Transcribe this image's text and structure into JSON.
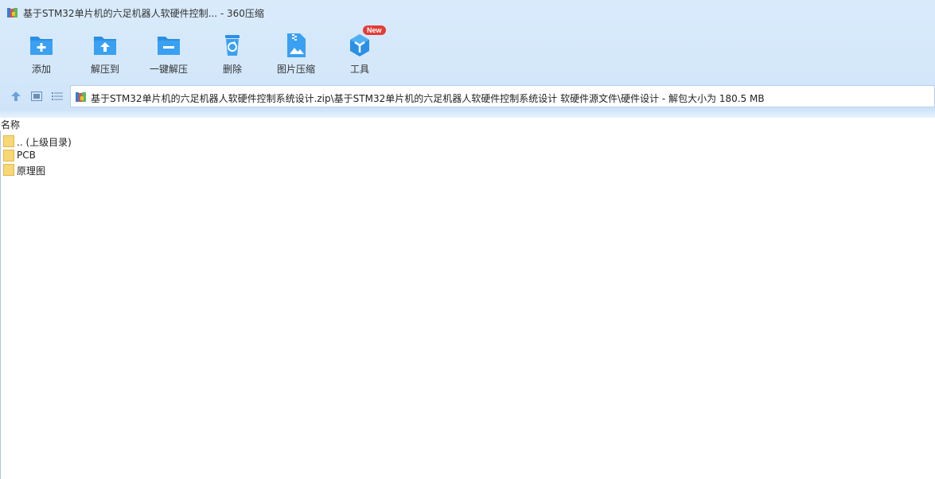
{
  "window": {
    "title": "基于STM32单片机的六足机器人软硬件控制... - 360压缩",
    "app_icon": "winrar-books-icon"
  },
  "toolbar": {
    "items": [
      {
        "label": "添加",
        "icon": "add-folder-icon"
      },
      {
        "label": "解压到",
        "icon": "extract-to-icon"
      },
      {
        "label": "一键解压",
        "icon": "one-click-extract-icon"
      },
      {
        "label": "删除",
        "icon": "recycle-bin-icon"
      },
      {
        "label": "图片压缩",
        "icon": "image-compress-icon"
      },
      {
        "label": "工具",
        "icon": "tools-cube-icon"
      }
    ],
    "new_badge": "New"
  },
  "address": {
    "path": "基于STM32单片机的六足机器人软硬件控制系统设计.zip\\基于STM32单片机的六足机器人软硬件控制系统设计 软硬件源文件\\硬件设计 - 解包大小为 180.5 MB"
  },
  "list": {
    "column_name": "名称",
    "items": [
      {
        "name": ".. (上级目录)",
        "type": "parent-folder"
      },
      {
        "name": "PCB",
        "type": "folder"
      },
      {
        "name": "原理图",
        "type": "folder"
      }
    ]
  },
  "colors": {
    "accent": "#2b8fe6",
    "chrome_bg": "#d5e8fa",
    "folder": "#f8d775",
    "badge": "#e43c36"
  }
}
